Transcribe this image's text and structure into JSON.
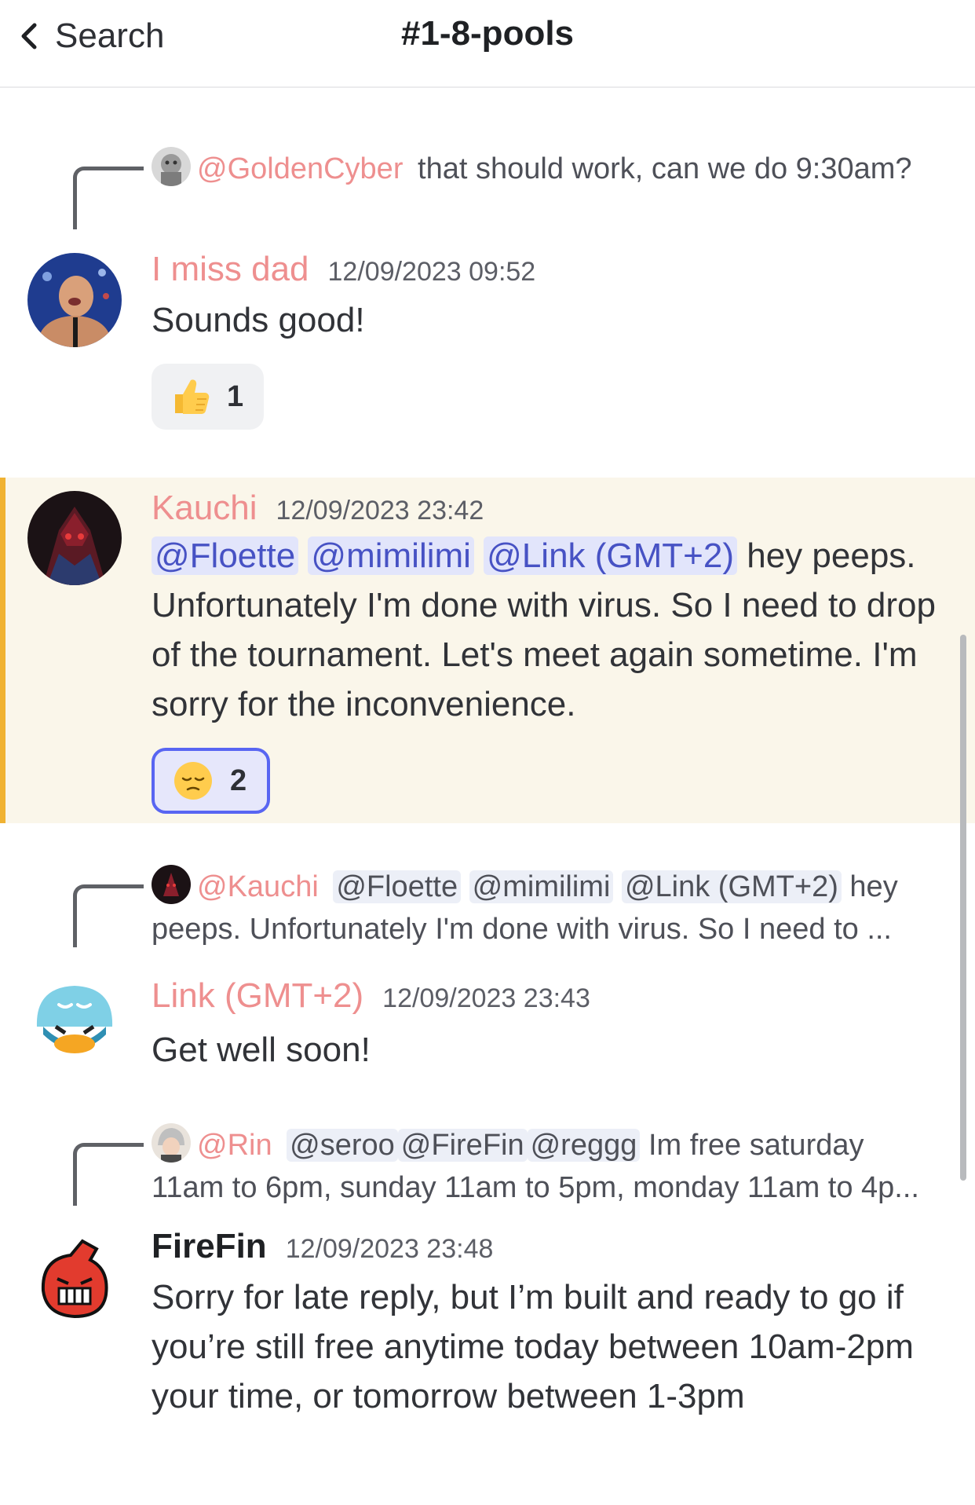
{
  "header": {
    "back_label": "Search",
    "channel_title": "#1-8-pools"
  },
  "messages": [
    {
      "reply": {
        "author": "@GoldenCyber",
        "text": "that should work, can we do 9:30am?"
      },
      "author": "I miss dad",
      "timestamp": "12/09/2023 09:52",
      "content": "Sounds good!",
      "reaction": {
        "emoji": "thumbs-up",
        "count": "1"
      }
    },
    {
      "author": "Kauchi",
      "timestamp": "12/09/2023 23:42",
      "mentions": [
        "@Floette",
        "@mimilimi",
        "@Link (GMT+2)"
      ],
      "content": "hey peeps. Unfortunately I'm done with virus. So I need to drop of the tournament. Let's meet again sometime. I'm sorry for the inconvenience.",
      "reaction": {
        "emoji": "pensive-face",
        "count": "2"
      }
    },
    {
      "reply": {
        "author": "@Kauchi",
        "mentions": [
          "@Floette",
          "@mimilimi",
          "@Link (GMT+2)"
        ],
        "text": "hey peeps. Unfortunately I'm done with virus. So I need to ..."
      },
      "author": "Link (GMT+2)",
      "timestamp": "12/09/2023 23:43",
      "content": "Get well soon!"
    },
    {
      "reply": {
        "author": "@Rin",
        "mentions": [
          "@seroo",
          "@FireFin",
          "@reggg"
        ],
        "text": "Im free saturday 11am to 6pm, sunday 11am to 5pm, monday 11am to 4p..."
      },
      "author": "FireFin",
      "timestamp": "12/09/2023 23:48",
      "content": "Sorry for late reply, but I’m built and ready to go if you’re still free anytime today between 10am-2pm your time, or tomorrow between 1-3pm"
    }
  ],
  "colors": {
    "username": "#ee8f8f",
    "mention_text": "#4752c4",
    "highlight_bg": "#faf6ea",
    "highlight_bar": "#f0b232",
    "active_reaction_border": "#5865f2"
  }
}
